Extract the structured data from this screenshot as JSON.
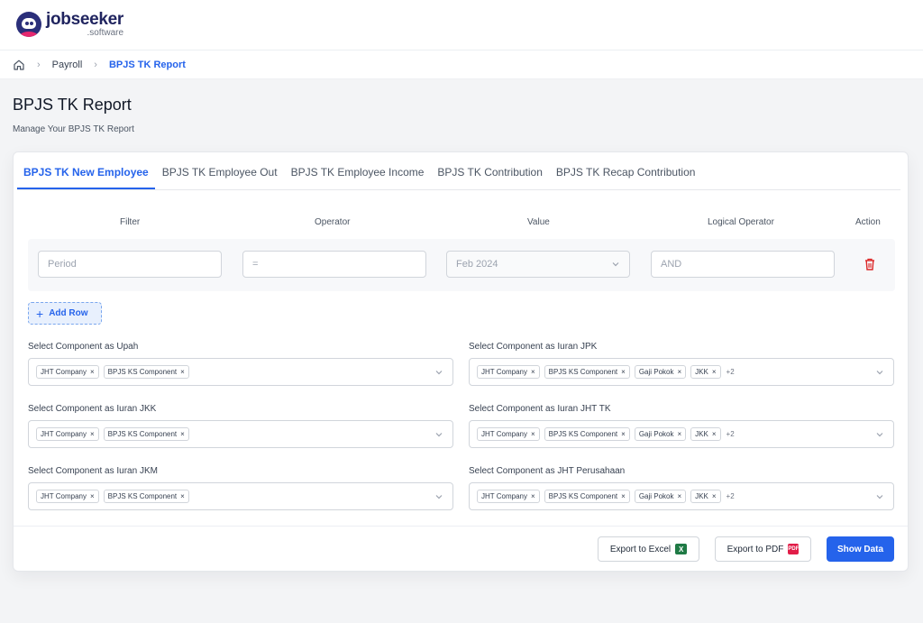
{
  "brand": {
    "name": "jobseeker",
    "sub": ".software"
  },
  "breadcrumb": {
    "items": [
      {
        "label": "Payroll"
      },
      {
        "label": "BPJS TK Report"
      }
    ]
  },
  "page": {
    "title": "BPJS TK Report",
    "subtitle": "Manage Your BPJS TK Report"
  },
  "tabs": [
    {
      "label": "BPJS TK New Employee",
      "active": true
    },
    {
      "label": "BPJS TK Employee Out"
    },
    {
      "label": "BPJS TK Employee Income"
    },
    {
      "label": "BPJS TK Contribution"
    },
    {
      "label": "BPJS TK Recap Contribution"
    }
  ],
  "filter": {
    "headers": {
      "filter": "Filter",
      "operator": "Operator",
      "value": "Value",
      "logical": "Logical Operator",
      "action": "Action"
    },
    "row": {
      "filter_placeholder": "Period",
      "operator_placeholder": "=",
      "value": "Feb 2024",
      "logical_placeholder": "AND"
    },
    "add_row_label": "Add Row"
  },
  "components": {
    "upah": {
      "label": "Select Component as Upah",
      "chips": [
        "JHT Company",
        "BPJS KS Component"
      ]
    },
    "jpk": {
      "label": "Select Component as Iuran JPK",
      "chips": [
        "JHT Company",
        "BPJS KS Component",
        "Gaji Pokok",
        "JKK"
      ],
      "more": "+2"
    },
    "jkk": {
      "label": "Select Component as Iuran JKK",
      "chips": [
        "JHT Company",
        "BPJS KS Component"
      ]
    },
    "jht_tk": {
      "label": "Select Component as Iuran JHT TK",
      "chips": [
        "JHT Company",
        "BPJS KS Component",
        "Gaji Pokok",
        "JKK"
      ],
      "more": "+2"
    },
    "jkm": {
      "label": "Select Component as Iuran JKM",
      "chips": [
        "JHT Company",
        "BPJS KS Component"
      ]
    },
    "jht_perusahaan": {
      "label": "Select Component as JHT Perusahaan",
      "chips": [
        "JHT Company",
        "BPJS KS Component",
        "Gaji Pokok",
        "JKK"
      ],
      "more": "+2"
    }
  },
  "actions": {
    "export_excel": "Export to Excel",
    "export_pdf": "Export to PDF",
    "show_data": "Show Data"
  },
  "icons": {
    "home": "home-icon",
    "excel": "excel-icon",
    "pdf": "pdf-icon",
    "trash": "trash-icon",
    "chevron": "chevron-down-icon",
    "plus": "plus-icon"
  },
  "colors": {
    "accent": "#2563eb",
    "danger": "#dc2626",
    "brand_navy": "#20245f",
    "brand_pink": "#e5286f"
  }
}
